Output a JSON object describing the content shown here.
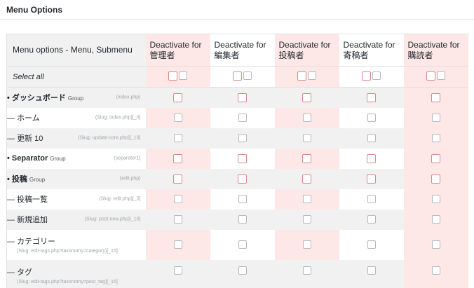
{
  "page": {
    "title": "Menu Options"
  },
  "table": {
    "first_header": "Menu options - Menu, Submenu",
    "role_headers": [
      {
        "line1": "Deactivate for",
        "line2": "管理者"
      },
      {
        "line1": "Deactivate for",
        "line2": "編集者"
      },
      {
        "line1": "Deactivate for",
        "line2": "投稿者"
      },
      {
        "line1": "Deactivate for",
        "line2": "寄稿者"
      },
      {
        "line1": "Deactivate for",
        "line2": "購読者"
      }
    ],
    "select_all_label": "Select all",
    "rows": [
      {
        "prefix": "•",
        "name": "ダッシュボード",
        "group": "Group",
        "slug": "(index.php)"
      },
      {
        "prefix": "—",
        "name": "ホーム",
        "slug": "(Slug: index.php)[_0]"
      },
      {
        "prefix": "—",
        "name": "更新 10",
        "slug": "(Slug: update-core.php)[_10]"
      },
      {
        "prefix": "•",
        "name": "Separator",
        "group": "Group",
        "slug": "(separator1)"
      },
      {
        "prefix": "•",
        "name": "投稿",
        "group": "Group",
        "slug": "(edit.php)"
      },
      {
        "prefix": "—",
        "name": "投稿一覧",
        "slug": "(Slug: edit.php)[_5]"
      },
      {
        "prefix": "—",
        "name": "新規追加",
        "slug": "(Slug: post-new.php)[_10]"
      },
      {
        "prefix": "—",
        "name": "カテゴリー",
        "slug": "(Slug: edit-tags.php?taxonomy=category)[_15]"
      },
      {
        "prefix": "—",
        "name": "タグ",
        "slug": "(Slug: edit-tags.php?taxonomy=post_tag)[_16]"
      }
    ]
  },
  "colors": {
    "pink": "#fde8e7",
    "grey": "#f1f1f1",
    "checkbox_red": "#d98b86"
  }
}
